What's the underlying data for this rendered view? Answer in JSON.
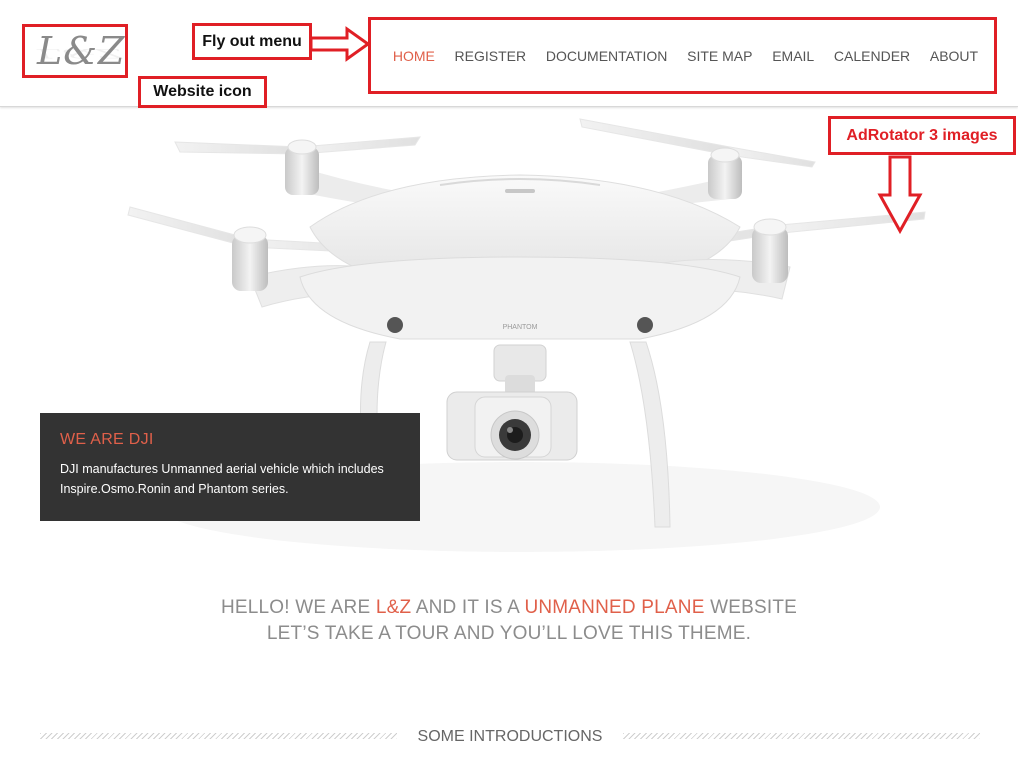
{
  "brand": {
    "logo_text": "L&Z"
  },
  "nav": {
    "items": [
      {
        "label": "HOME",
        "active": true
      },
      {
        "label": "REGISTER",
        "active": false
      },
      {
        "label": "DOCUMENTATION",
        "active": false
      },
      {
        "label": "SITE MAP",
        "active": false
      },
      {
        "label": "EMAIL",
        "active": false
      },
      {
        "label": "CALENDER",
        "active": false
      },
      {
        "label": "ABOUT",
        "active": false
      }
    ]
  },
  "annotations": {
    "flyout": "Fly out menu",
    "website_icon": "Website icon",
    "adrotator": "AdRotator 3 images"
  },
  "slider": {
    "caption_title": "WE ARE DJI",
    "caption_line1": "DJI manufactures Unmanned aerial vehicle which includes",
    "caption_line2": "Inspire.Osmo.Ronin and Phantom series.",
    "drone_model_text": "PHANTOM"
  },
  "tagline": {
    "l1_a": "HELLO! WE ARE ",
    "l1_b": "L&Z",
    "l1_c": " AND IT IS A ",
    "l1_d": "UNMANNED PLANE",
    "l1_e": " WEBSITE",
    "line2": "LET’S TAKE A TOUR AND YOU’LL LOVE THIS THEME."
  },
  "section": {
    "title": "SOME INTRODUCTIONS"
  },
  "colors": {
    "accent": "#e0604a",
    "annotation": "#e01f25",
    "caption_bg": "#333333"
  }
}
